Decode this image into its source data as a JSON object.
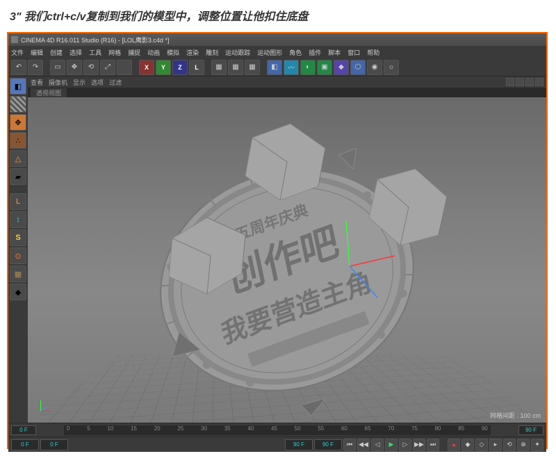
{
  "instruction_text": "3\" 我们ctrl+c/v复制到我们的模型中，调整位置让他扣住底盘",
  "titlebar": {
    "text": "CINEMA 4D R16.011 Studio (R16) - [LOL鹰影3.c4d *]"
  },
  "menubar": {
    "items": [
      "文件",
      "编辑",
      "创建",
      "选择",
      "工具",
      "网格",
      "捕捉",
      "动画",
      "模拟",
      "渲染",
      "雕刻",
      "运动跟踪",
      "运动图形",
      "角色",
      "插件",
      "脚本",
      "窗口",
      "帮助"
    ]
  },
  "toolbar": {
    "undo": "↶",
    "redo": "↷",
    "sel": "▭",
    "move": "✥",
    "rot": "⟲",
    "scale": "⤢",
    "x": "X",
    "y": "Y",
    "z": "Z",
    "lock": "L",
    "rend1": "▦",
    "rend2": "▦",
    "rend3": "▦",
    "prim": "◧",
    "spline": "〰",
    "nurbs": "◐",
    "arr": "▣",
    "def": "◆",
    "env": "⬡",
    "cam": "◉",
    "light": "☼"
  },
  "left_tools": {
    "cube": "◧",
    "chk": "▦",
    "move": "✥",
    "pts": "∴",
    "edge": "△",
    "face": "▰",
    "l": "L",
    "m": "↕",
    "s": "S",
    "mag": "⊙",
    "w": "▦",
    "sn": "◆"
  },
  "viewport": {
    "header_items": [
      "查看",
      "摄像机",
      "显示",
      "选项",
      "过滤"
    ],
    "tab": "透视视图",
    "info": "网格间距 : 100 cm",
    "model_text_top": "五周年庆典",
    "model_text_main": "创作吧",
    "model_text_sub": "我要营造主角"
  },
  "timeline": {
    "start": "0 F",
    "nums": [
      "0",
      "5",
      "10",
      "15",
      "20",
      "25",
      "30",
      "35",
      "40",
      "45",
      "50",
      "55",
      "60",
      "65",
      "70",
      "75",
      "80",
      "85",
      "90"
    ],
    "end": "90 F"
  },
  "bottombar": {
    "f1": "0 F",
    "f2": "0 F",
    "f3": "90 F",
    "f4": "90 F",
    "first": "⏮",
    "prev": "◀◀",
    "prevk": "◁",
    "play": "▶",
    "nextk": "▷",
    "next": "▶▶",
    "last": "⏭",
    "rec": "●",
    "key": "◆",
    "auto": "◇",
    "t": "▸",
    "r": "⟲",
    "s": "⊕",
    "p": "✦"
  }
}
